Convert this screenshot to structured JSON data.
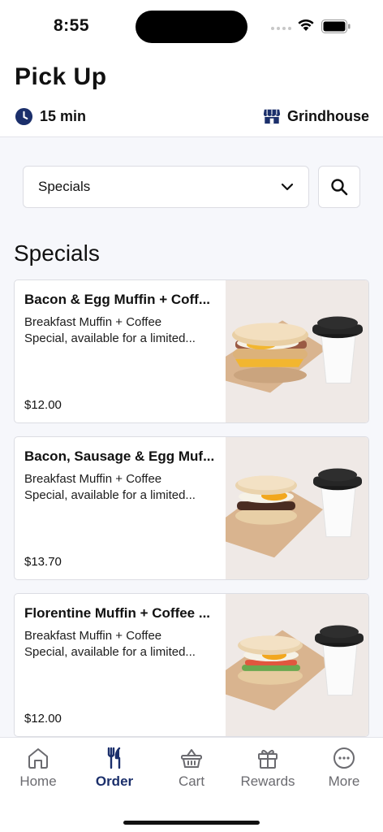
{
  "status_bar": {
    "time": "8:55"
  },
  "header": {
    "title": "Pick Up",
    "prep_time": "15 min",
    "store_name": "Grindhouse"
  },
  "filter": {
    "selected_category": "Specials"
  },
  "section": {
    "title": "Specials"
  },
  "products": [
    {
      "name": "Bacon & Egg Muffin + Coff...",
      "description_line1": "Breakfast Muffin + Coffee",
      "description_line2": "Special, available for a limited...",
      "price": "$12.00",
      "image": "bacon-egg-muffin-coffee-photo"
    },
    {
      "name": "Bacon, Sausage & Egg Muf...",
      "description_line1": "Breakfast Muffin + Coffee",
      "description_line2": "Special, available for a limited...",
      "price": "$13.70",
      "image": "bacon-sausage-egg-muffin-coffee-photo"
    },
    {
      "name": "Florentine Muffin + Coffee ...",
      "description_line1": "Breakfast Muffin + Coffee",
      "description_line2": "Special, available for a limited...",
      "price": "$12.00",
      "image": "florentine-muffin-coffee-photo"
    }
  ],
  "tab_bar": {
    "tabs": [
      {
        "label": "Home",
        "icon": "home-icon",
        "active": false
      },
      {
        "label": "Order",
        "icon": "fork-knife-icon",
        "active": true
      },
      {
        "label": "Cart",
        "icon": "basket-icon",
        "active": false
      },
      {
        "label": "Rewards",
        "icon": "gift-icon",
        "active": false
      },
      {
        "label": "More",
        "icon": "more-dots-icon",
        "active": false
      }
    ]
  },
  "colors": {
    "accent": "#1b2f6b",
    "inactive": "#6b6b70",
    "page_background": "#f6f7fb"
  }
}
